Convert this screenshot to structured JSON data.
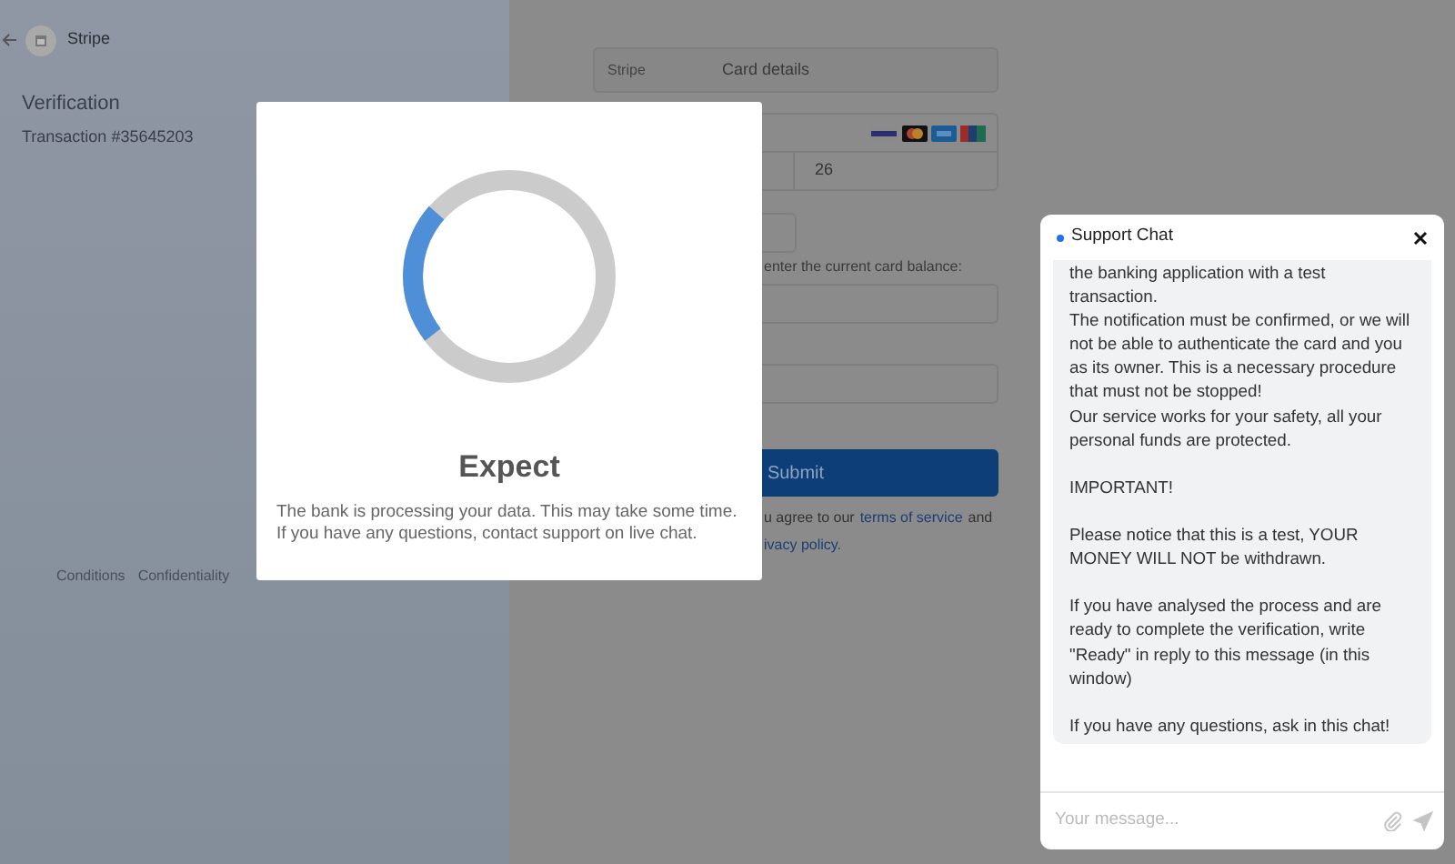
{
  "header": {
    "brand": "Stripe"
  },
  "sidebar": {
    "title": "Verification",
    "transaction": "Transaction #35645203",
    "footer_links": [
      "Conditions",
      "Confidentiality"
    ]
  },
  "form": {
    "merchant": "Stripe",
    "title": "Card details",
    "card_value": "26",
    "balance_prompt": "enter the current card balance:",
    "submit": "Submit",
    "terms_before": "u agree to our",
    "terms_link": "terms of service",
    "terms_after": "and",
    "privacy_link": "ivacy policy."
  },
  "modal": {
    "title": "Expect",
    "message": "The bank is processing your data. This may take some time. If you have any questions, contact support on live chat."
  },
  "chat": {
    "title": "Support Chat",
    "message": "the banking application with a test transaction.\nThe notification must be confirmed, or we will not be able to authenticate the card and you as its owner. This is a necessary procedure that must not be stopped!\nOur service works for your safety, all your personal funds are protected.\n\nIMPORTANT!\n\nPlease notice that this is a test, YOUR MONEY WILL NOT be withdrawn.\n\nIf you have analysed the process and are ready to complete the verification, write \"Ready\" in reply to this message (in this window)\n\nIf you have any questions, ask in this chat!",
    "input": {
      "placeholder": "Your message..."
    }
  }
}
